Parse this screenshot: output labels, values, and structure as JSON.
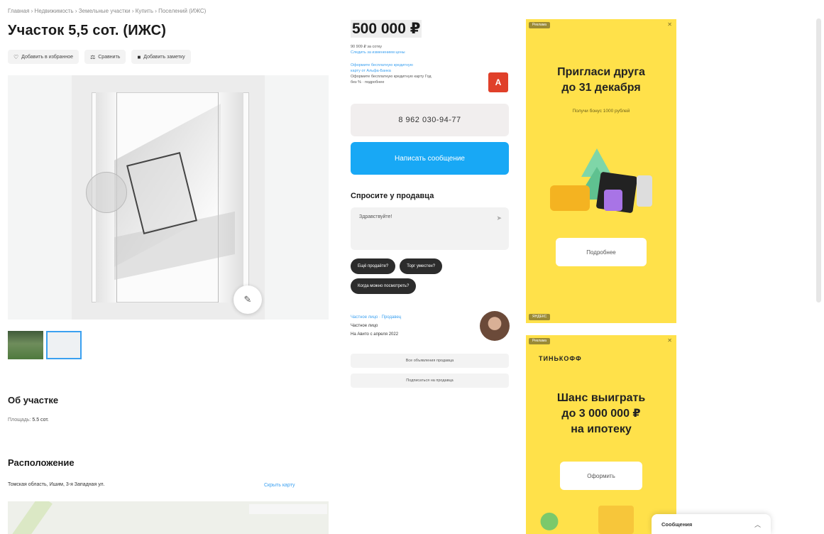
{
  "breadcrumbs": "Главная › Недвижимость › Земельные участки › Купить › Поселений (ИЖС)",
  "title": "Участок 5,5 сот. (ИЖС)",
  "actions": {
    "favorite": "Добавить в избранное",
    "compare": "Сравнить",
    "note": "Добавить заметку"
  },
  "gallery": {
    "thumbs_count": 2,
    "active_thumb": 2
  },
  "about": {
    "heading": "Об участке",
    "area_label": "Площадь:",
    "area_value": "5.5 сот."
  },
  "location": {
    "heading": "Расположение",
    "address": "Томская область, Ишим, 3-я Западная ул.",
    "show_map": "Скрыть карту"
  },
  "price": {
    "value": "500 000 ₽",
    "per_unit": "90 909 ₽ за сотку",
    "history_link": "Следить за изменением цены",
    "credit_line1": "Оформите бесплатную кредитную",
    "credit_line2": "карту от Альфа-Банка",
    "credit_line3": "Оформите бесплатную кредитную карту Год",
    "credit_line4": "без % · подробнее",
    "bank_logo": "А"
  },
  "contact": {
    "phone": "8 962 030-94-77",
    "write_button": "Написать сообщение"
  },
  "ask": {
    "title": "Спросите у продавца",
    "input_value": "Здравствуйте!",
    "chips": [
      "Ещё продаёте?",
      "Торг уместен?",
      "Когда можно посмотреть?"
    ]
  },
  "seller": {
    "name": "Частное лицо · Продавец",
    "type": "Частное лицо",
    "since": "На Авито с апреля 2022",
    "subscribe": "Подписаться на продавца",
    "other": "Все объявления продавца"
  },
  "ads": {
    "tag": "Реклама",
    "tag_bottom": "ЯНДЕКС",
    "ad1_title_l1": "Пригласи друга",
    "ad1_title_l2": "до 31 декабря",
    "ad1_sub": "Получи бонус 1000 рублей",
    "ad1_button": "Подробнее",
    "ad2_brand": "ТИНЬКОФФ",
    "ad2_title_l1": "Шанс выиграть",
    "ad2_title_l2": "до 3 000 000 ₽",
    "ad2_title_l3": "на ипотеку",
    "ad2_button": "Оформить"
  },
  "messenger": {
    "label": "Сообщения"
  },
  "colors": {
    "accent_blue": "#18a8f5",
    "ad_yellow": "#ffe14a",
    "chip_dark": "#2c2c2c",
    "bank_red": "#e0402a"
  },
  "icons": {
    "favorite": "heart-icon",
    "compare": "scales-icon",
    "note": "note-icon",
    "edit": "pencil-icon",
    "close": "close-icon",
    "chevron": "chevron-up-icon",
    "send": "send-icon"
  }
}
